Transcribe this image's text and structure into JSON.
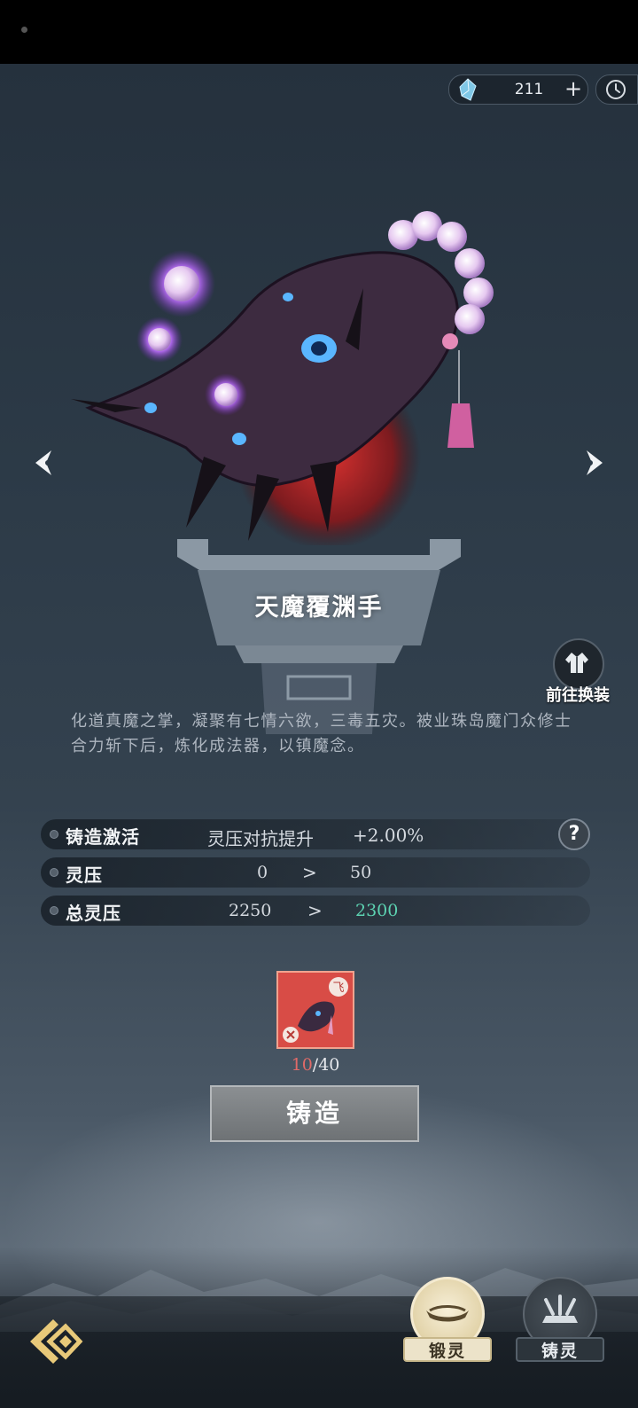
{
  "currency": {
    "icon": "spirit-crystal-icon",
    "amount": "211",
    "add": "+"
  },
  "item": {
    "name": "天魔覆渊手",
    "description": "化道真魔之掌，凝聚有七情六欲，三毒五灾。被业珠岛魔门众修士合力斩下后，炼化成法器，以镇魔念。"
  },
  "change_outfit": {
    "label": "前往换装"
  },
  "stats": [
    {
      "name": "铸造激活",
      "effect": "灵压对抗提升",
      "value": "+2.00%"
    },
    {
      "name": "灵压",
      "from": "0",
      "arrow": ">",
      "to": "50"
    },
    {
      "name": "总灵压",
      "from": "2250",
      "arrow": ">",
      "to": "2300"
    }
  ],
  "help": "?",
  "material": {
    "badge": "飞",
    "current": "10",
    "sep": "/",
    "required": "40"
  },
  "forge_button": "铸造",
  "tabs": [
    {
      "label": "锻灵",
      "active": true
    },
    {
      "label": "铸灵",
      "active": false
    }
  ],
  "colors": {
    "increase": "#5dd3b2",
    "insufficient": "#e06a68",
    "panel": "#2c3a47"
  }
}
